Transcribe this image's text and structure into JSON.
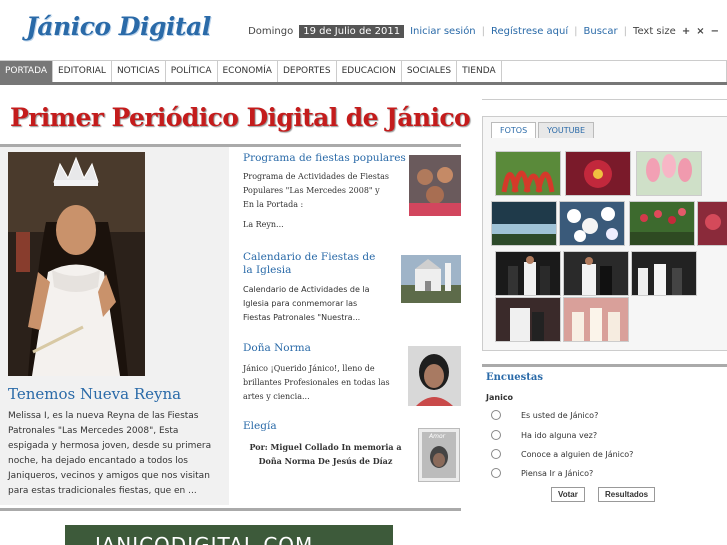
{
  "site": {
    "logo": "Jánico Digital"
  },
  "topbar": {
    "day": "Domingo",
    "date": "19 de Julio de 2011",
    "login": "Iniciar sesión",
    "register": "Regístrese aquí",
    "search": "Buscar",
    "textsize": "Text size",
    "icons": [
      "plus-icon",
      "reset-icon",
      "minus-icon"
    ]
  },
  "nav": {
    "items": [
      "PORTADA",
      "EDITORIAL",
      "NOTICIAS",
      "POLÍTICA",
      "ECONOMÍA",
      "DEPORTES",
      "EDUCACION",
      "SOCIALES",
      "TIENDA"
    ],
    "active": 0
  },
  "headline": "Primer Periódico Digital de Jánico",
  "feature": {
    "title": "Tenemos Nueva Reyna",
    "text": "Melissa I, es la nueva Reyna de las Fiestas Patronales \"Las Mercedes 2008\", Esta espigada y hermosa joven, desde su primera noche, ha dejado encantado a todos los Janiqueros, vecinos y amigos que nos visitan para estas tradicionales fiestas, que en ..."
  },
  "stories": [
    {
      "title": "Programa de fiestas populares",
      "text": "Programa de Actividades de Fiestas Populares \"Las Mercedes 2008\" y En la Portada :",
      "more": "La Reyn..."
    },
    {
      "title": "Calendario de Fiestas de la Iglesia",
      "text": "Calendario de Actividades de la Iglesia para conmemorar las Fiestas Patronales \"Nuestra..."
    },
    {
      "title": "Doña Norma",
      "text": "Jánico ¡Querido Jánico!, lleno de brillantes Profesionales en todas las artes y ciencia..."
    },
    {
      "title": "Elegía",
      "text": "Por:  Miguel Collado In memoria a  Doña Norma De Jesús de Díaz",
      "thumb_caption": "Amor"
    }
  ],
  "banner": {
    "text": "JANICODIGITAL.COM"
  },
  "media": {
    "tabs": [
      "FOTOS",
      "YOUTUBE"
    ],
    "active": 0
  },
  "poll": {
    "title": "Encuestas",
    "question": "Janico",
    "options": [
      "Es usted de Jánico?",
      "Ha ido alguna vez?",
      "Conoce a alguien de Jánico?",
      "Piensa Ir a Jánico?"
    ],
    "vote": "Votar",
    "results": "Resultados"
  },
  "colors": {
    "link": "#2a6aa8",
    "headline": "#c41c1c",
    "nav_active": "#777777"
  }
}
